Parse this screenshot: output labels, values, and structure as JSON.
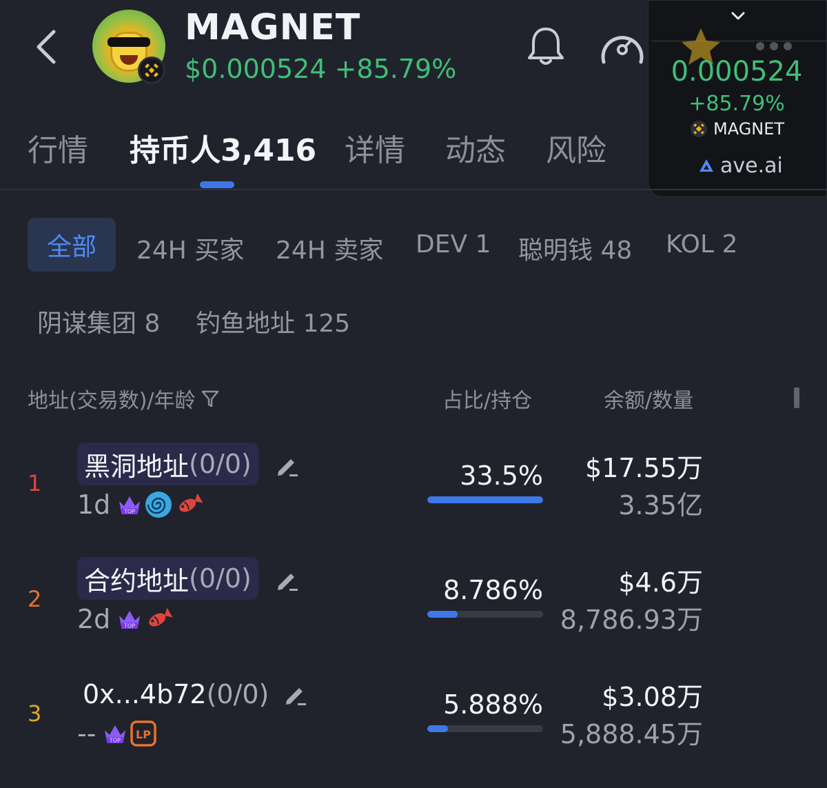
{
  "header": {
    "token_name": "MAGNET",
    "price_line": "$0.000524 +85.79%"
  },
  "widget": {
    "price": "0.000524",
    "change": "+85.79%",
    "symbol": "MAGNET",
    "site": "ave.ai"
  },
  "main_tabs": [
    {
      "label": "行情"
    },
    {
      "label": "持币人3,416"
    },
    {
      "label": "详情"
    },
    {
      "label": "动态"
    },
    {
      "label": "风险"
    }
  ],
  "active_tab": "持币人3,416",
  "filters": [
    {
      "label": "全部"
    },
    {
      "label": "24H 买家"
    },
    {
      "label": "24H 卖家"
    },
    {
      "label": "DEV 1"
    },
    {
      "label": "聪明钱 48"
    },
    {
      "label": "KOL 2"
    },
    {
      "label": "阴谋集团 8"
    },
    {
      "label": "钓鱼地址 125"
    }
  ],
  "columns": {
    "address": "地址(交易数)/年龄",
    "share": "占比/持仓",
    "balance": "余额/数量"
  },
  "holders": [
    {
      "rank": "1",
      "name": "黑洞地址",
      "tx": "(0/0)",
      "age": "1d",
      "tags": [
        "crown-top-icon",
        "spiral-icon",
        "fish-icon"
      ],
      "share": "33.5%",
      "share_value": 0.335,
      "usd": "$17.55万",
      "qty": "3.35亿",
      "rank_color": "#e0443c"
    },
    {
      "rank": "2",
      "name": "合约地址",
      "tx": "(0/0)",
      "age": "2d",
      "tags": [
        "crown-top-icon",
        "fish-icon"
      ],
      "share": "8.786%",
      "share_value": 0.08786,
      "usd": "$4.6万",
      "qty": "8,786.93万",
      "rank_color": "#e8722c"
    },
    {
      "rank": "3",
      "name": "0x...4b72",
      "tx": "(0/0)",
      "age": "--",
      "tags": [
        "crown-top-icon",
        "lp-icon"
      ],
      "share": "5.888%",
      "share_value": 0.05888,
      "usd": "$3.08万",
      "qty": "5,888.45万",
      "rank_color": "#e0a628"
    }
  ],
  "colors": {
    "accent_blue": "#3e78e8",
    "price_green": "#3fbf78",
    "background": "#20232b"
  }
}
